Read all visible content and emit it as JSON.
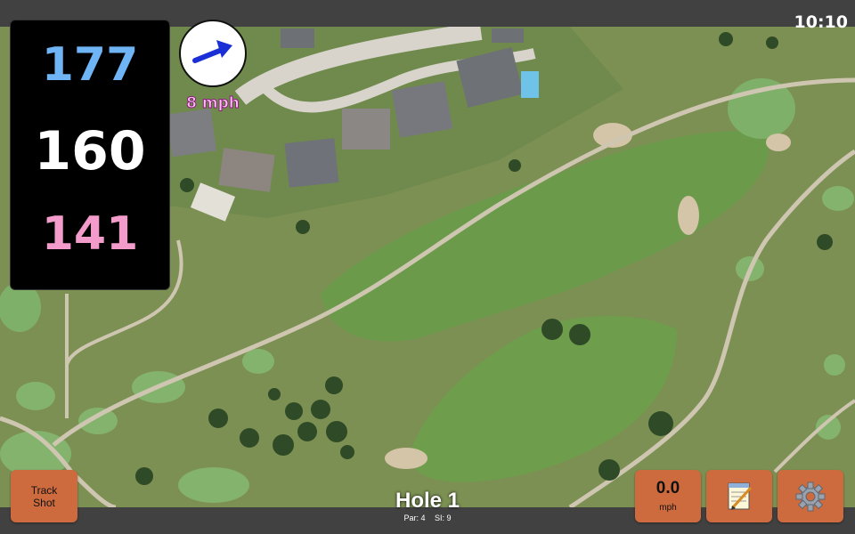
{
  "status": {
    "time": "10:10"
  },
  "distances": {
    "back": "177",
    "middle": "160",
    "front": "141"
  },
  "wind": {
    "speed": "8 mph",
    "direction_icon": "wind-arrow-icon"
  },
  "hole": {
    "title": "Hole 1",
    "par": "Par: 4",
    "stroke_index": "SI: 9"
  },
  "buttons": {
    "track_shot": "Track Shot",
    "speed_value": "0.0",
    "speed_unit": "mph",
    "notes_icon": "notepad-icon",
    "settings_icon": "gear-icon"
  },
  "colors": {
    "back_distance": "#6fb5f5",
    "middle_distance": "#ffffff",
    "front_distance": "#f39ccc",
    "button": "#cd6b3e"
  }
}
